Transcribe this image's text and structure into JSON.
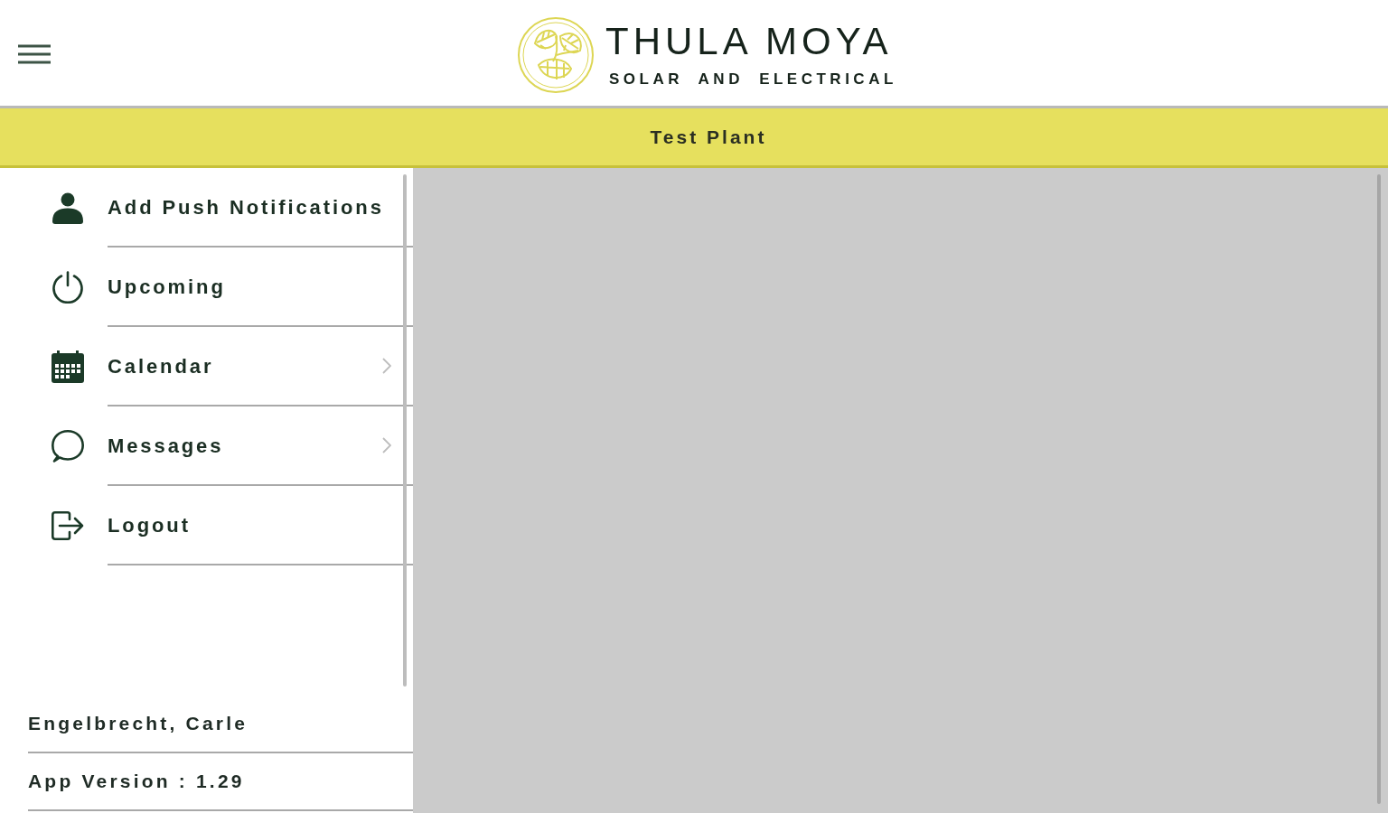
{
  "header": {
    "logo": {
      "name": "THULA MOYA",
      "tagline": "SOLAR AND ELECTRICAL"
    }
  },
  "plant_bar": {
    "title": "Test Plant"
  },
  "sidebar": {
    "items": [
      {
        "label": "Add Push Notifications",
        "expandable": false
      },
      {
        "label": "Upcoming",
        "expandable": false
      },
      {
        "label": "Calendar",
        "expandable": true
      },
      {
        "label": "Messages",
        "expandable": true
      },
      {
        "label": "Logout",
        "expandable": false
      }
    ],
    "user": "Engelbrecht, Carle",
    "app_version": "App Version : 1.29"
  }
}
